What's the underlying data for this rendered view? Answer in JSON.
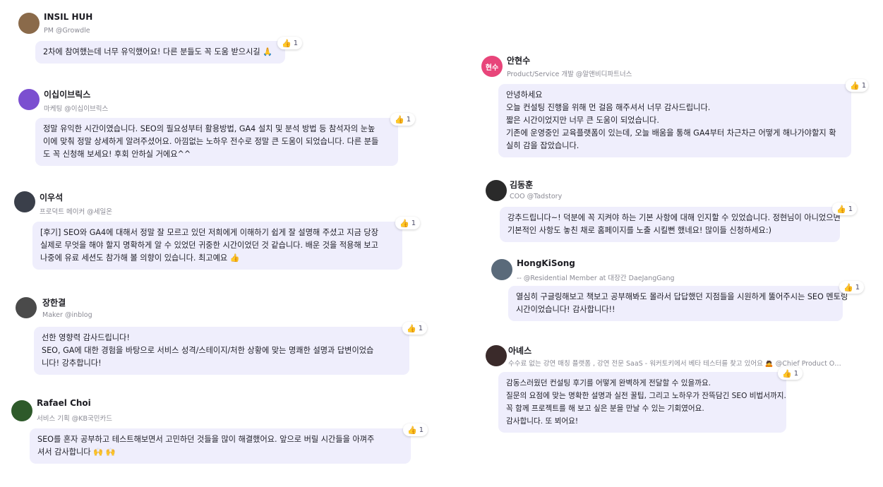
{
  "comments": [
    {
      "id": "insil",
      "name": "INSIL HUH",
      "role": "PM @Growdle",
      "avatar_label": "",
      "avatar_color": "#8a6a4a",
      "lines": [
        "2차에 참여했는데 너무 유익했어요! 다른 분들도 꼭 도움 받으시길 🙏"
      ],
      "reaction": "1"
    },
    {
      "id": "2bricks",
      "name": "이십이브릭스",
      "role": "마케팅 @이십이브릭스",
      "avatar_label": "",
      "avatar_color": "#7b4fd0",
      "lines": [
        "정말 유익한 시간이였습니다. SEO의 필요성부터 활용방법, GA4 설치 및 분석 방법 등 참석자의 눈높",
        "이에 맞춰 정말 상세하게 알려주셨어요. 아낌없는 노하우 전수로 정말 큰 도움이 되었습니다. 다른 분들",
        "도 꼭 신청해 보세요! 후회 안하실 거에요^^"
      ],
      "reaction": "1"
    },
    {
      "id": "woosuk",
      "name": "이우석",
      "role": "프로덕트 메이커 @세일온",
      "avatar_label": "",
      "avatar_color": "#3a3f4a",
      "lines": [
        "[후기] SEO와 GA4에 대해서 정말 잘 모르고 있던 저희에게 이해하기 쉽게 잘 설명해 주셨고 지금 당장",
        "실제로 무엇을 해야 할지 명확하게 알 수 있었던 귀중한 시간이었던 것 같습니다. 배운 것을 적용해 보고",
        "나중에 유료 세션도 참가해 볼 의향이 있습니다. 최고예요 👍"
      ],
      "reaction": "1"
    },
    {
      "id": "hangyeol",
      "name": "장한결",
      "role": "Maker @inblog",
      "avatar_label": "",
      "avatar_color": "#4a4a4a",
      "lines": [
        "선한 영향력 감사드립니다!",
        "SEO, GA에 대한 경험을 바탕으로 서비스 성격/스테이지/처한 상황에 맞는 명쾌한 설명과 답변이었습",
        "니다! 강추합니다!"
      ],
      "reaction": "1"
    },
    {
      "id": "rafael",
      "name": "Rafael Choi",
      "role": "서비스 기획 @KB국민카드",
      "avatar_label": "",
      "avatar_color": "#2e5a2a",
      "lines": [
        "SEO를 혼자 공부하고 테스트해보면서 고민하던 것들을 많이 해결했어요. 앞으로 버릴 시간들을 아껴주",
        "셔서 감사합니다 🙌 🙌"
      ],
      "reaction": "1"
    },
    {
      "id": "hyunsoo",
      "name": "안현수",
      "role": "Product/Service 개발 @알앤비디파트너스",
      "avatar_label": "현수",
      "avatar_color": "#e8457a",
      "lines": [
        "안녕하세요",
        "오늘 컨설팅 진행을 위해 먼 걸음 해주셔서 너무 감사드립니다.",
        "짧은 시간이었지만 너무 큰 도움이 되었습니다.",
        "기존에 운영중인 교육플랫폼이 있는데, 오늘 배움을 통해 GA4부터 차근차근 어떻게 해나가야할지 확",
        "실히 감을 잡았습니다."
      ],
      "reaction": "1"
    },
    {
      "id": "donghoon",
      "name": "김동훈",
      "role": "COO @Tadstory",
      "avatar_label": "",
      "avatar_color": "#2a2a2a",
      "lines": [
        "강추드립니다~! 덕분에 꼭 지켜야 하는 기본 사항에 대해 인지할 수 있었습니다. 정현님이 아니었으면",
        "기본적인 사항도 놓친 채로 홈페이지를 노출 시킬뻔 했네요! 많이들 신청하세요:)"
      ],
      "reaction": "1"
    },
    {
      "id": "hongki",
      "name": "HongKiSong",
      "role": "-- @Residential Member at 대장간 DaeJangGang",
      "avatar_label": "",
      "avatar_color": "#5a6a7a",
      "lines": [
        "열심히 구글링해보고 책보고 공부해봐도 몰라서 답답했던 지점들을 시원하게 뚫어주시는 SEO 멘토링",
        "시간이었습니다! 감사합니다!!"
      ],
      "reaction": "1"
    },
    {
      "id": "agnes",
      "name": "아녜스",
      "role": "수수료 없는 강연 매칭 플랫폼 , 강연 전문 SaaS - 워커토키에서 베타 테스터를 찾고 있어요 🙇 @Chief Product Officer at ...",
      "avatar_label": "",
      "avatar_color": "#3a2a2a",
      "lines": [
        "감동스러웠던 컨설팅 후기를 어떻게 완벽하게 전달할 수 있을까요.",
        "질문의 요점에 맞는 명확한 설명과 실전 꿀팁, 그리고 노하우가 잔뜩담긴 SEO 비법서까지.",
        "꼭 함께 프로젝트를 해 보고 싶은 분을 만날 수 있는 기회였어요.",
        "감사합니다. 또 뵈어요!"
      ],
      "reaction": "1"
    }
  ]
}
